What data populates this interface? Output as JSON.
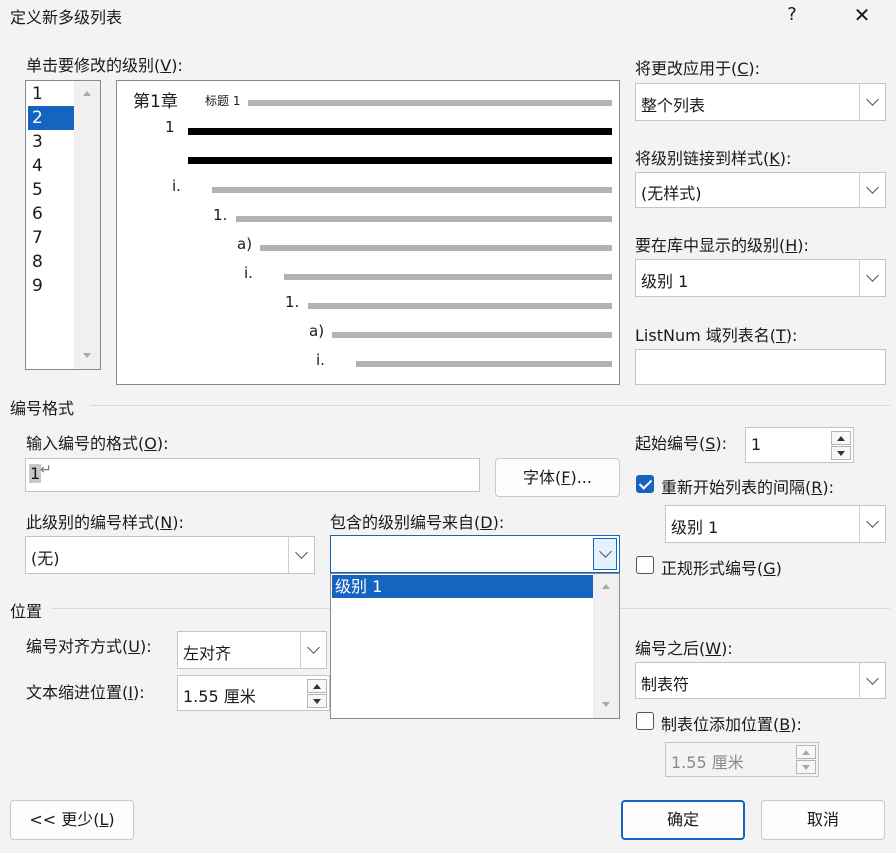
{
  "window": {
    "title": "定义新多级列表",
    "help": "?",
    "close": "✕"
  },
  "level_list": {
    "label_pre": "单击要修改的级别(",
    "label_key": "V",
    "label_post": "):",
    "items": [
      "1",
      "2",
      "3",
      "4",
      "5",
      "6",
      "7",
      "8",
      "9"
    ],
    "selected_index": 1
  },
  "preview": {
    "heading_num": "第1章",
    "heading_style": "标题 1",
    "levels": [
      "1",
      "",
      "i.",
      "1.",
      "a)",
      "i.",
      "1.",
      "a)",
      "i."
    ]
  },
  "apply_to": {
    "label_pre": "将更改应用于(",
    "label_key": "C",
    "label_post": "):",
    "value": "整个列表"
  },
  "link_style": {
    "label_pre": "将级别链接到样式(",
    "label_key": "K",
    "label_post": "):",
    "value": "(无样式)"
  },
  "gallery_level": {
    "label_pre": "要在库中显示的级别(",
    "label_key": "H",
    "label_post": "):",
    "value": "级别 1"
  },
  "listnum": {
    "label_pre": "ListNum 域列表名(",
    "label_key": "T",
    "label_post": "):",
    "value": ""
  },
  "number_format": {
    "section": "编号格式",
    "format_label_pre": "输入编号的格式(",
    "format_label_key": "O",
    "format_label_post": "):",
    "format_value": "1",
    "format_mark": "↵",
    "font_button_pre": "字体(",
    "font_button_key": "F",
    "font_button_post": ")...",
    "style_label_pre": "此级别的编号样式(",
    "style_label_key": "N",
    "style_label_post": "):",
    "style_value": "(无)",
    "include_label_pre": "包含的级别编号来自(",
    "include_label_key": "D",
    "include_label_post": "):",
    "include_value": "",
    "include_options": [
      "级别 1"
    ],
    "start_label_pre": "起始编号(",
    "start_label_key": "S",
    "start_label_post": "):",
    "start_value": "1",
    "restart_label_pre": "重新开始列表的间隔(",
    "restart_label_key": "R",
    "restart_label_post": "):",
    "restart_checked": true,
    "restart_value": "级别 1",
    "legal_label_pre": "正规形式编号(",
    "legal_label_key": "G",
    "legal_label_post": ")",
    "legal_checked": false
  },
  "position": {
    "section": "位置",
    "align_label_pre": "编号对齐方式(",
    "align_label_key": "U",
    "align_label_post": "):",
    "align_value": "左对齐",
    "indent_label_pre": "文本缩进位置(",
    "indent_label_key": "I",
    "indent_label_post": "):",
    "indent_value": "1.55 厘米",
    "after_label_pre": "编号之后(",
    "after_label_key": "W",
    "after_label_post": "):",
    "after_value": "制表符",
    "tab_label_pre": "制表位添加位置(",
    "tab_label_key": "B",
    "tab_label_post": "):",
    "tab_checked": false,
    "tab_value": "1.55 厘米"
  },
  "footer": {
    "less_pre": "<< 更少(",
    "less_key": "L",
    "less_post": ")",
    "ok": "确定",
    "cancel": "取消"
  },
  "colors": {
    "accent": "#1565c0",
    "selection": "#1565c0"
  }
}
